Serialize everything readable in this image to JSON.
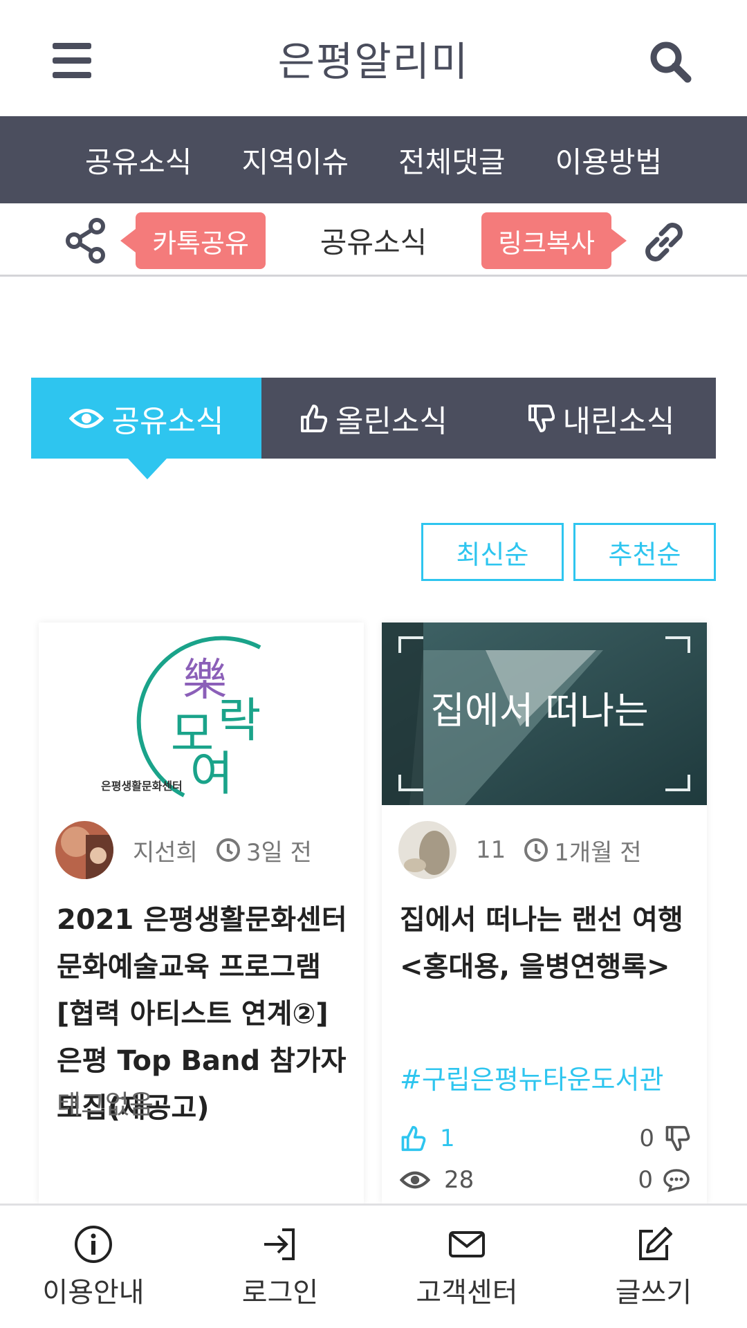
{
  "header": {
    "title": "은평알리미",
    "menu_icon": "hamburger-menu-icon",
    "search_icon": "search-icon"
  },
  "nav": {
    "items": [
      "공유소식",
      "지역이슈",
      "전체댓글",
      "이용방법"
    ]
  },
  "share": {
    "kakao_label": "카톡공유",
    "center_label": "공유소식",
    "link_label": "링크복사"
  },
  "tabs": [
    {
      "label": "공유소식",
      "icon": "eye-icon",
      "active": true
    },
    {
      "label": "올린소식",
      "icon": "thumbs-up-icon"
    },
    {
      "label": "내린소식",
      "icon": "thumbs-down-icon"
    }
  ],
  "sort": {
    "latest": "최신순",
    "recommend": "추천순"
  },
  "posts": [
    {
      "thumb_text_1": "樂",
      "thumb_text_2": "모",
      "thumb_text_3": "락",
      "thumb_text_4": "여",
      "thumb_caption": "은평생활문화센터",
      "author": "지선희",
      "time": "3일 전",
      "title": "2021 은평생활문화센터 문화예술교육 프로그램 [협력 아티스트 연계②] 은평 Top Band 참가자 모집(재공고)",
      "tags": "태그없음"
    },
    {
      "thumb_text": "집에서 떠나는",
      "author": "11",
      "time": "1개월 전",
      "title": "집에서 떠나는 랜선 여행 <홍대용, 을병연행록>",
      "tags": "#구립은평뉴타운도서관",
      "likes": "1",
      "dislikes": "0",
      "views": "28",
      "comments": "0"
    }
  ],
  "bottom": {
    "guide": "이용안내",
    "login": "로그인",
    "support": "고객센터",
    "write": "글쓰기"
  },
  "colors": {
    "accent": "#2ec5ef",
    "nav_bg": "#4b4e5e",
    "pill": "#f47b7b"
  }
}
